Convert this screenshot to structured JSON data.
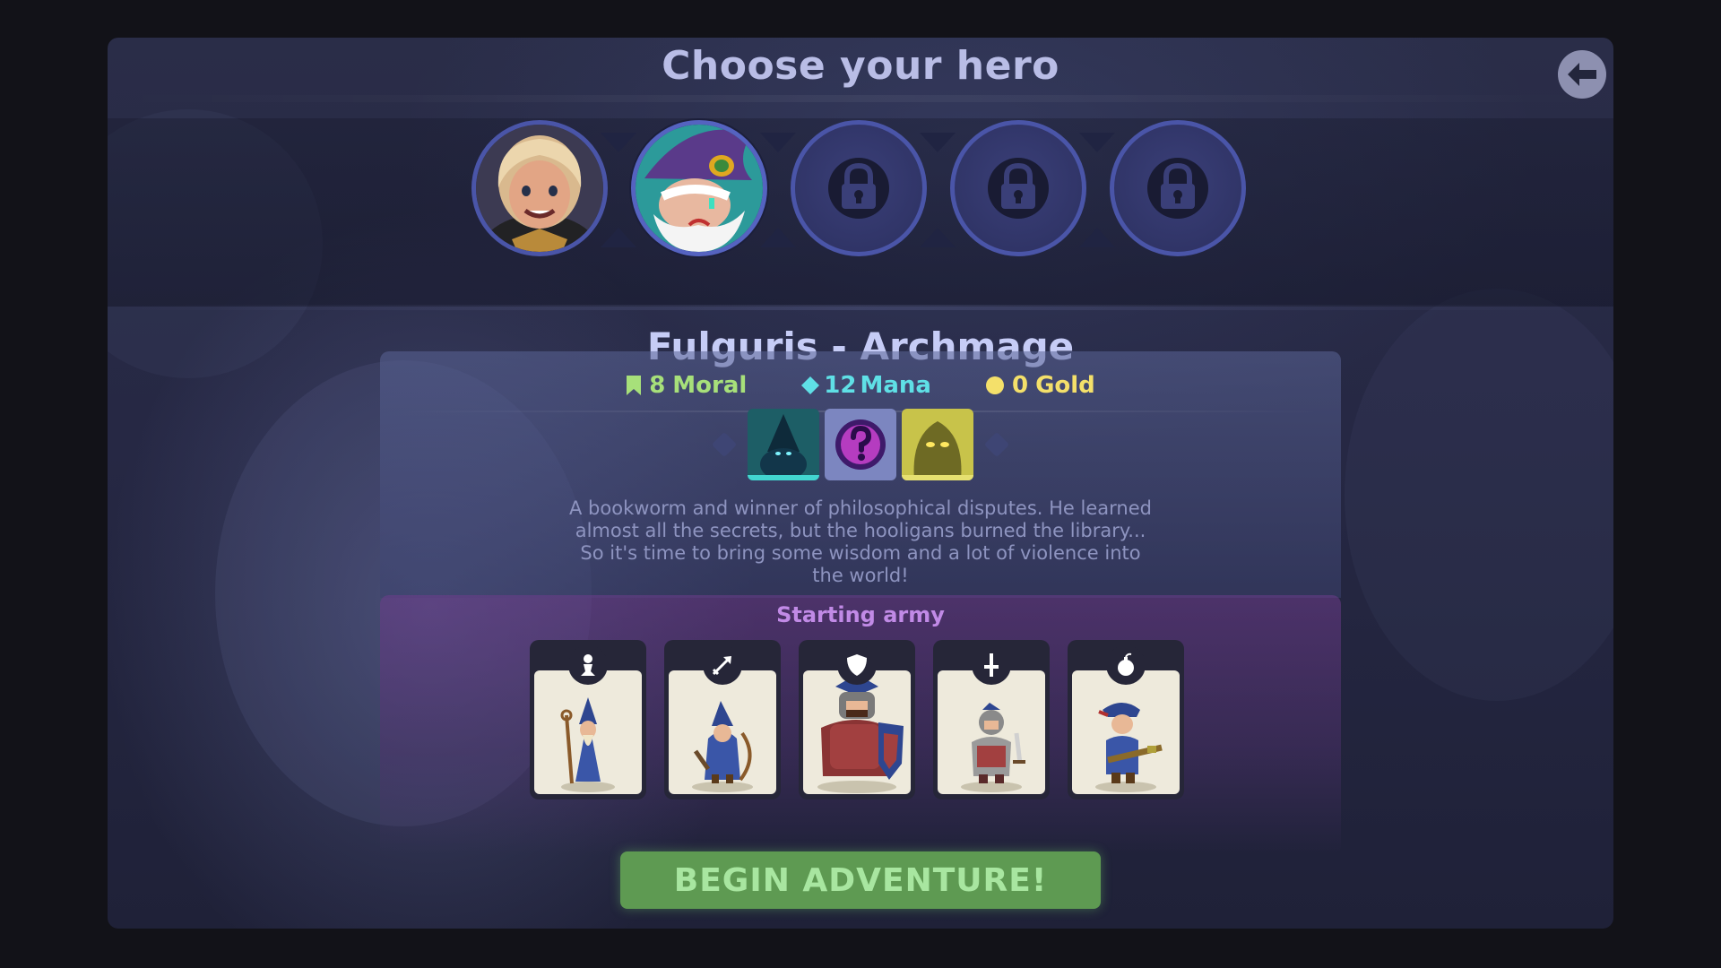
{
  "screen": {
    "title": "Choose your hero",
    "back_icon": "arrow-left-icon"
  },
  "heroes": [
    {
      "state": "unlocked",
      "icon": "blonde-warrior-portrait"
    },
    {
      "state": "selected",
      "icon": "wizard-portrait"
    },
    {
      "state": "locked",
      "icon": "lock-icon"
    },
    {
      "state": "locked",
      "icon": "lock-icon"
    },
    {
      "state": "locked",
      "icon": "lock-icon"
    }
  ],
  "hero": {
    "name": "Fulguris - Archmage",
    "stats": {
      "moral": {
        "value": "8",
        "label": "Moral",
        "icon": "bookmark-icon",
        "color": "#a7e07a"
      },
      "mana": {
        "value": "12",
        "label": "Mana",
        "icon": "diamond-icon",
        "color": "#5fe0e6"
      },
      "gold": {
        "value": "0",
        "label": "Gold",
        "icon": "coin-icon",
        "color": "#f4e06a"
      }
    },
    "spells": [
      {
        "icon": "dark-wizard-spell-icon"
      },
      {
        "icon": "mystery-spell-icon"
      },
      {
        "icon": "yellow-ghost-spell-icon"
      }
    ],
    "description": "A bookworm and winner of philosophical disputes. He learned almost all the secrets, but the hooligans burned the library... So it's time to bring some wisdom and a lot of violence into the world!"
  },
  "army": {
    "title": "Starting army",
    "units": [
      {
        "badge_icon": "pawn-icon",
        "unit": "blue-mage-unit"
      },
      {
        "badge_icon": "arrow-icon",
        "unit": "archer-unit"
      },
      {
        "badge_icon": "shield-icon",
        "unit": "shield-knight-unit"
      },
      {
        "badge_icon": "sword-icon",
        "unit": "swordsman-unit"
      },
      {
        "badge_icon": "bomb-icon",
        "unit": "musketeer-unit"
      }
    ]
  },
  "actions": {
    "begin_label": "BEGIN ADVENTURE!"
  },
  "colors": {
    "accent_green": "#5e9a52",
    "hero_ring": "#4a55a8",
    "title_text": "#b9bde6",
    "army_title": "#c18ae6"
  }
}
